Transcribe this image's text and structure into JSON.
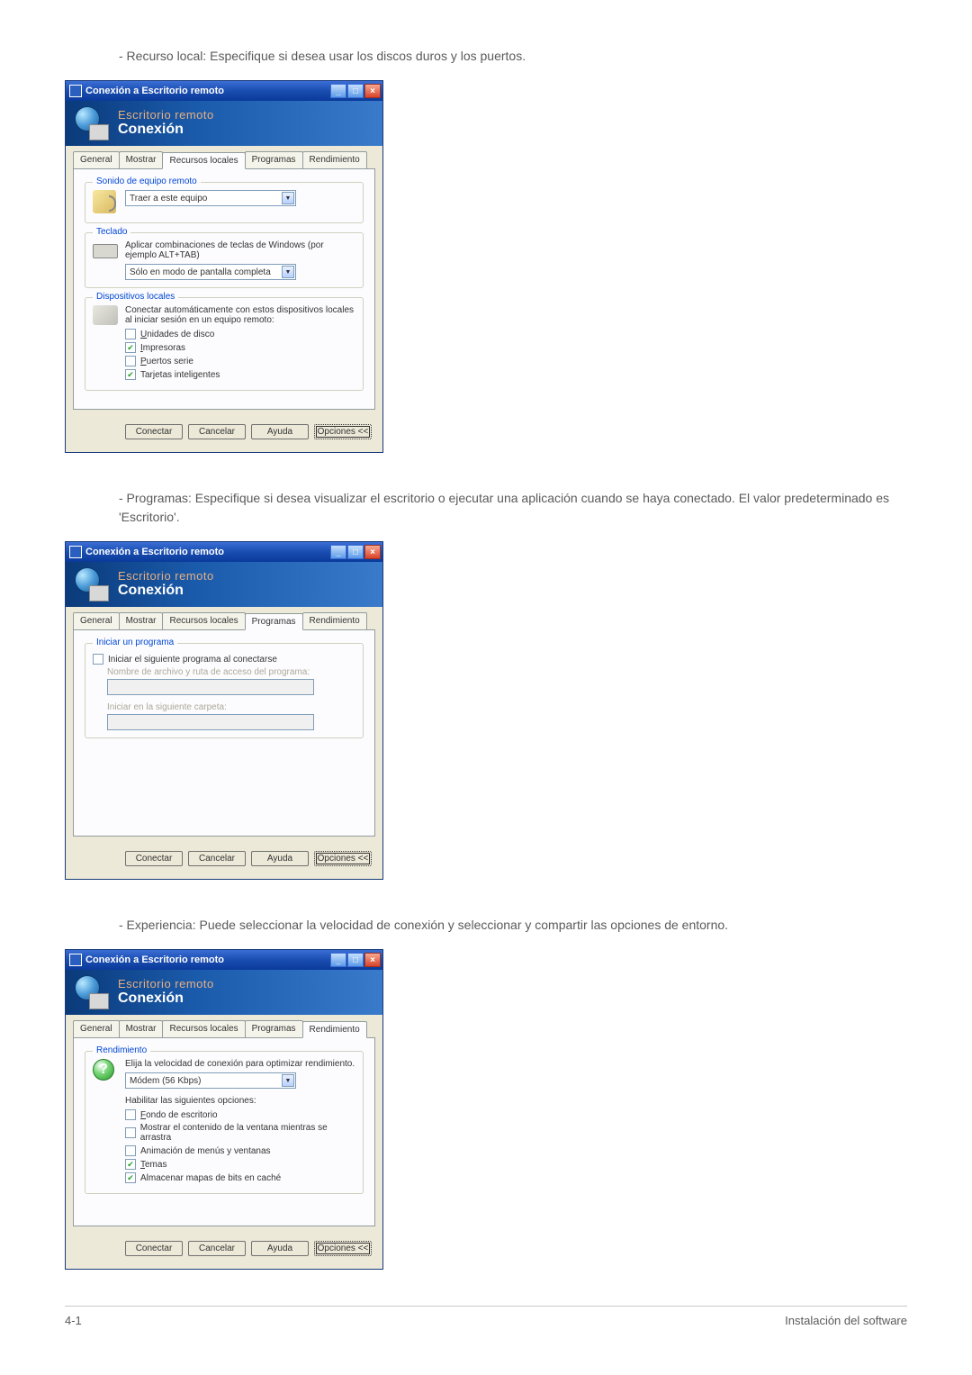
{
  "paragraphs": {
    "p1": "- Recurso local: Especifique si desea usar los discos duros y los puertos.",
    "p2": "- Programas: Especifique si desea visualizar el escritorio o ejecutar una aplicación cuando se haya conectado. El valor predeterminado es 'Escritorio'.",
    "p3": "- Experiencia: Puede seleccionar la velocidad de conexión y seleccionar y compartir las opciones de entorno."
  },
  "window": {
    "title": "Conexión a Escritorio remoto",
    "header_line1": "Escritorio remoto",
    "header_line2": "Conexión"
  },
  "tabs": {
    "general": "General",
    "mostrar": "Mostrar",
    "recursos": "Recursos locales",
    "programas": "Programas",
    "rendimiento": "Rendimiento"
  },
  "recursos_panel": {
    "sonido_group": "Sonido de equipo remoto",
    "sonido_dropdown": "Traer a este equipo",
    "teclado_group": "Teclado",
    "teclado_label": "Aplicar combinaciones de teclas de Windows (por ejemplo ALT+TAB)",
    "teclado_dropdown": "Sólo en modo de pantalla completa",
    "dispositivos_group": "Dispositivos locales",
    "dispositivos_label": "Conectar automáticamente con estos dispositivos locales al iniciar sesión en un equipo remoto:",
    "cb_unidades": "Unidades de disco",
    "cb_impresoras": "Impresoras",
    "cb_puertos": "Puertos serie",
    "cb_tarjetas": "Tarjetas inteligentes"
  },
  "programas_panel": {
    "iniciar_group": "Iniciar un programa",
    "cb_iniciar": "Iniciar el siguiente programa al conectarse",
    "label_nombre": "Nombre de archivo y ruta de acceso del programa:",
    "label_carpeta": "Iniciar en la siguiente carpeta:"
  },
  "rendimiento_panel": {
    "group": "Rendimiento",
    "label_elija": "Elija la velocidad de conexión para optimizar rendimiento.",
    "dropdown": "Módem (56 Kbps)",
    "label_habilitar": "Habilitar las siguientes opciones:",
    "cb_fondo": "Fondo de escritorio",
    "cb_mostrar_contenido": "Mostrar el contenido de la ventana mientras se arrastra",
    "cb_animacion": "Animación de menús y ventanas",
    "cb_temas": "Temas",
    "cb_cache": "Almacenar mapas de bits en caché"
  },
  "buttons": {
    "conectar": "Conectar",
    "cancelar": "Cancelar",
    "ayuda": "Ayuda",
    "opciones": "Opciones <<"
  },
  "footer": {
    "left": "4-1",
    "right": "Instalación del software"
  }
}
